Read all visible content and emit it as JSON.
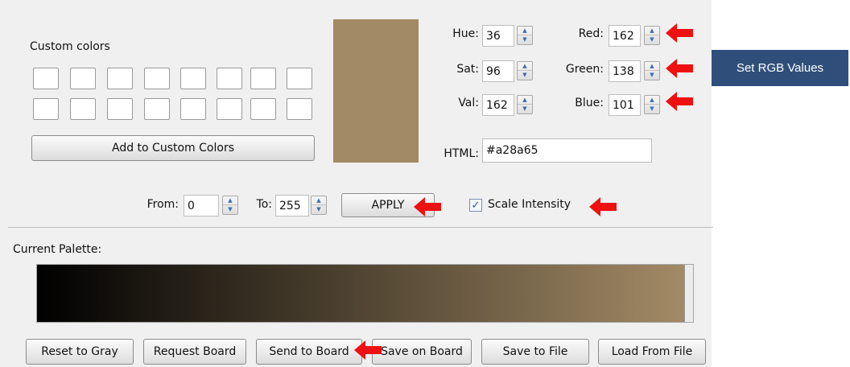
{
  "custom_colors": {
    "title": "Custom colors",
    "add_button": "Add to Custom Colors"
  },
  "preview": {
    "color": "#a28a65"
  },
  "hsv": {
    "hue_label": "Hue:",
    "hue": "36",
    "sat_label": "Sat:",
    "sat": "96",
    "val_label": "Val:",
    "val": "162"
  },
  "rgb": {
    "red_label": "Red:",
    "red": "162",
    "green_label": "Green:",
    "green": "138",
    "blue_label": "Blue:",
    "blue": "101"
  },
  "html": {
    "label": "HTML:",
    "value": "#a28a65"
  },
  "range": {
    "from_label": "From:",
    "from": "0",
    "to_label": "To:",
    "to": "255",
    "apply": "APPLY",
    "scale_label": "Scale Intensity",
    "scale_checked": true
  },
  "palette": {
    "title": "Current Palette:",
    "start_color": "#000000",
    "end_color": "#a28a65"
  },
  "buttons": {
    "reset": "Reset to Gray",
    "request": "Request Board",
    "send": "Send to Board",
    "save_board": "Save on Board",
    "save_file": "Save to File",
    "load_file": "Load From File"
  },
  "callout": {
    "text": "Set RGB Values",
    "color": "#2f4f7a"
  },
  "arrow_color": "#ee1111"
}
